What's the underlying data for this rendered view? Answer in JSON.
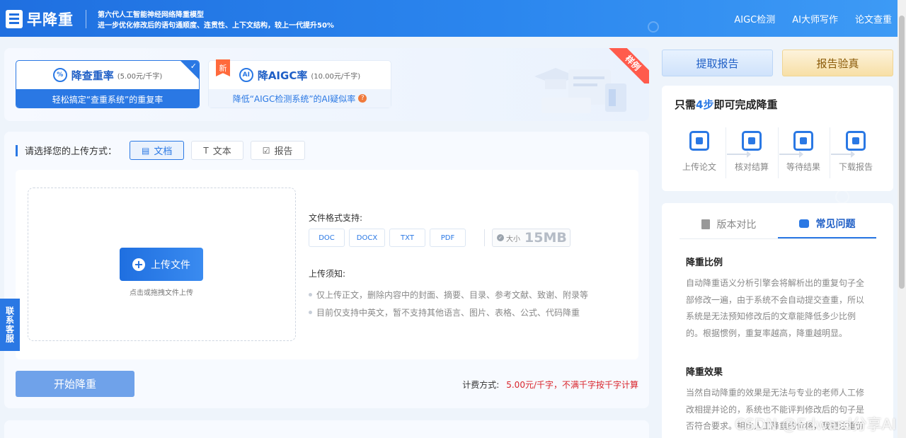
{
  "header": {
    "logo_text": "早降重",
    "slogan_line1": "第六代人工智能神经网络降重模型",
    "slogan_line2": "进一步优化修改后的语句通顺度、连贯性、上下文结构，较上一代提升50%",
    "nav": [
      "AIGC检测",
      "AI大师写作",
      "论文查重"
    ]
  },
  "service_tabs": [
    {
      "title": "降查重率",
      "price": "(5.00元/千字)",
      "desc": "轻松搞定“查重系统”的重复率",
      "icon": "%"
    },
    {
      "title": "降AIGC率",
      "price": "(10.00元/千字)",
      "desc": "降低“AIGC检测系统”的AI疑似率",
      "badge": "新",
      "icon": "AI",
      "help": "?"
    }
  ],
  "sample_ribbon": "样例",
  "upload": {
    "mode_label": "请选择您的上传方式：",
    "modes": [
      {
        "label": "文档",
        "icon": "document-icon",
        "glyph": "▤"
      },
      {
        "label": "文本",
        "icon": "text-icon",
        "glyph": "T"
      },
      {
        "label": "报告",
        "icon": "report-icon",
        "glyph": "☑"
      }
    ],
    "upload_button": "上传文件",
    "upload_hint": "点击或拖拽文件上传",
    "formats_title": "文件格式支持:",
    "formats": [
      "DOC",
      "DOCX",
      "TXT",
      "PDF"
    ],
    "size_label": "大小",
    "size_value": "15MB",
    "notice_title": "上传须知:",
    "notices": [
      "仅上传正文，删除内容中的封面、摘要、目录、参考文献、致谢、附录等",
      "目前仅支持中英文，暂不支持其他语言、图片、表格、公式、代码降重"
    ],
    "start_button": "开始降重",
    "billing_label": "计费方式:",
    "billing_value": "5.00元/千字，不满千字按千字计算"
  },
  "contact": "联系客服",
  "right": {
    "get_report": "提取报告",
    "verify_report": "报告验真",
    "steps_title_pre": "只需",
    "steps_title_hl": "4步",
    "steps_title_post": "即可完成降重",
    "steps": [
      "上传论文",
      "核对结算",
      "等待结果",
      "下载报告"
    ],
    "faq_tabs": [
      "版本对比",
      "常见问题"
    ],
    "faq": [
      {
        "h": "降重比例",
        "p": "自动降重语义分析引擎会将解析出的重复句子全部修改一遍，由于系统不会自动提交查重，所以系统是无法预知修改后的文章能降低多少比例的。根据惯例，重复率越高，降重越明显。"
      },
      {
        "h": "降重效果",
        "p": "当然自动降重的效果是无法与专业的老师人工修改相提并论的，系统也不能评判修改后的句子是否符合要求。相比人工降重的价格，我更注重价比。"
      }
    ]
  },
  "watermark": "CSDN @Edward分享AI"
}
